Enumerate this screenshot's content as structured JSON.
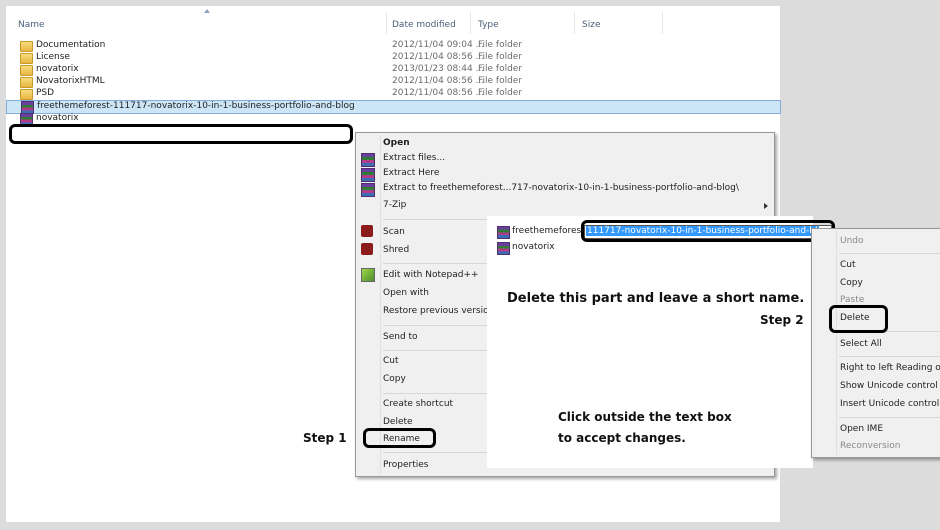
{
  "columns": {
    "name": "Name",
    "date": "Date modified",
    "type": "Type",
    "size": "Size"
  },
  "files": [
    {
      "name": "Documentation",
      "date": "2012/11/04 09:04 ...",
      "type": "File folder",
      "icon": "folder-icon"
    },
    {
      "name": "License",
      "date": "2012/11/04 08:56 ...",
      "type": "File folder",
      "icon": "folder-icon"
    },
    {
      "name": "novatorix",
      "date": "2013/01/23 08:44 ...",
      "type": "File folder",
      "icon": "folder-icon"
    },
    {
      "name": "NovatorixHTML",
      "date": "2012/11/04 08:56 ...",
      "type": "File folder",
      "icon": "folder-icon"
    },
    {
      "name": "PSD",
      "date": "2012/11/04 08:56 ...",
      "type": "File folder",
      "icon": "folder-icon"
    }
  ],
  "selected_file": {
    "name": "freethemeforest-111717-novatorix-10-in-1-business-portfolio-and-blog",
    "icon": "winrar-archive-icon"
  },
  "second_file": {
    "name": "novatorix",
    "icon": "winrar-archive-icon"
  },
  "context_menu": {
    "open": "Open",
    "extract_files": "Extract files...",
    "extract_here": "Extract Here",
    "extract_to": "Extract to freethemeforest...717-novatorix-10-in-1-business-portfolio-and-blog\\",
    "seven_zip": "7-Zip",
    "scan": "Scan",
    "shred": "Shred",
    "edit_notepad": "Edit with Notepad++",
    "open_with": "Open with",
    "restore": "Restore previous version",
    "send_to": "Send to",
    "cut": "Cut",
    "copy": "Copy",
    "create_shortcut": "Create shortcut",
    "delete": "Delete",
    "rename": "Rename",
    "properties": "Properties"
  },
  "inset": {
    "file_prefix": "freethemeforest",
    "file_selected_text": "111717-novatorix-10-in-1-business-portfolio-and-bl",
    "second_file": "novatorix"
  },
  "edit_menu": {
    "undo": "Undo",
    "cut": "Cut",
    "copy": "Copy",
    "paste": "Paste",
    "delete": "Delete",
    "select_all": "Select All",
    "rtl": "Right to left Reading or",
    "show_unicode": "Show Unicode control c",
    "insert_unicode": "Insert Unicode control c",
    "open_ime": "Open IME",
    "reconversion": "Reconversion"
  },
  "annotations": {
    "step1": "Step 1",
    "step2": "Step 2",
    "instruction_delete": "Delete this part and leave a short name.",
    "instruction_click_line1": "Click outside the text box",
    "instruction_click_line2": "to accept changes."
  },
  "colors": {
    "selection": "#cde6f7",
    "text_highlight": "#3399ff",
    "menu_bg": "#f0f0f0"
  }
}
